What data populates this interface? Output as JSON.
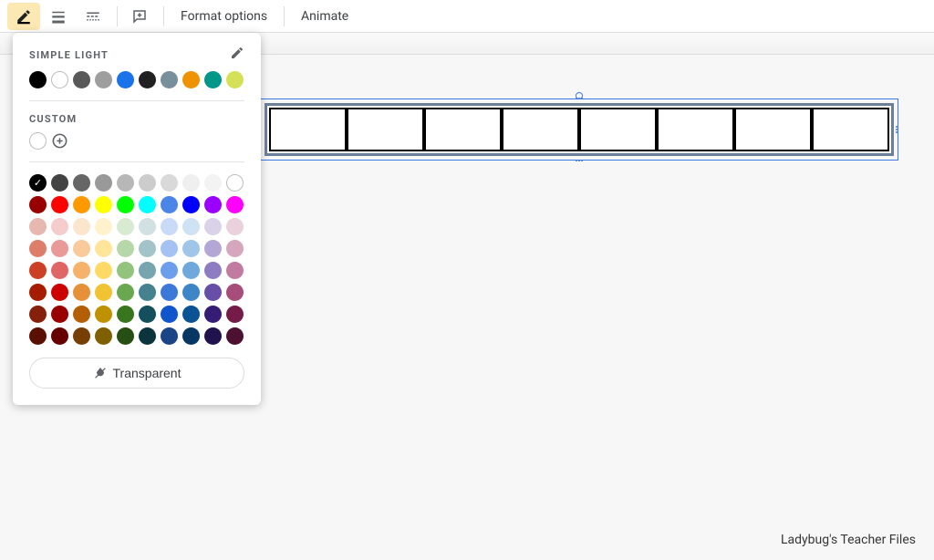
{
  "toolbar": {
    "format_options_label": "Format options",
    "animate_label": "Animate"
  },
  "popover": {
    "theme_title": "SIMPLE LIGHT",
    "custom_title": "CUSTOM",
    "transparent_label": "Transparent",
    "theme_colors": [
      {
        "hex": "#000000",
        "outline": false
      },
      {
        "hex": "#ffffff",
        "outline": true
      },
      {
        "hex": "#595959",
        "outline": false
      },
      {
        "hex": "#9e9e9e",
        "outline": false
      },
      {
        "hex": "#1a73e8",
        "outline": false
      },
      {
        "hex": "#212121",
        "outline": false
      },
      {
        "hex": "#78909c",
        "outline": false
      },
      {
        "hex": "#f09300",
        "outline": false
      },
      {
        "hex": "#009688",
        "outline": false
      },
      {
        "hex": "#d4e157",
        "outline": false
      }
    ],
    "custom_colors": [
      {
        "hex": "#ffffff",
        "outline": true
      }
    ],
    "grays": [
      {
        "hex": "#000000",
        "selected": true
      },
      {
        "hex": "#434343"
      },
      {
        "hex": "#666666"
      },
      {
        "hex": "#999999"
      },
      {
        "hex": "#b7b7b7"
      },
      {
        "hex": "#cccccc"
      },
      {
        "hex": "#d9d9d9"
      },
      {
        "hex": "#efefef"
      },
      {
        "hex": "#f3f3f3"
      },
      {
        "hex": "#ffffff",
        "outline": true
      }
    ],
    "primaries": [
      {
        "hex": "#980000"
      },
      {
        "hex": "#ff0000"
      },
      {
        "hex": "#ff9900"
      },
      {
        "hex": "#ffff00"
      },
      {
        "hex": "#00ff00"
      },
      {
        "hex": "#00ffff"
      },
      {
        "hex": "#4a86e8"
      },
      {
        "hex": "#0000ff"
      },
      {
        "hex": "#9900ff"
      },
      {
        "hex": "#ff00ff"
      }
    ],
    "tints": [
      [
        "#e6b8af",
        "#f4cccc",
        "#fce5cd",
        "#fff2cc",
        "#d9ead3",
        "#d0e0e3",
        "#c9daf8",
        "#cfe2f3",
        "#d9d2e9",
        "#ead1dc"
      ],
      [
        "#dd7e6b",
        "#ea9999",
        "#f9cb9c",
        "#ffe599",
        "#b6d7a8",
        "#a2c4c9",
        "#a4c2f4",
        "#9fc5e8",
        "#b4a7d6",
        "#d5a6bd"
      ],
      [
        "#cc4125",
        "#e06666",
        "#f6b26b",
        "#ffd966",
        "#93c47d",
        "#76a5af",
        "#6d9eeb",
        "#6fa8dc",
        "#8e7cc3",
        "#c27ba0"
      ],
      [
        "#a61c00",
        "#cc0000",
        "#e69138",
        "#f1c232",
        "#6aa84f",
        "#45818e",
        "#3c78d8",
        "#3d85c6",
        "#674ea7",
        "#a64d79"
      ],
      [
        "#85200c",
        "#990000",
        "#b45f06",
        "#bf9000",
        "#38761d",
        "#134f5c",
        "#1155cc",
        "#0b5394",
        "#351c75",
        "#741b47"
      ],
      [
        "#5b0f00",
        "#660000",
        "#783f04",
        "#7f6000",
        "#274e13",
        "#0c343d",
        "#1c4587",
        "#073763",
        "#20124d",
        "#4c1130"
      ]
    ]
  },
  "watermark": "Ladybug's Teacher Files",
  "table": {
    "columns": 8
  }
}
